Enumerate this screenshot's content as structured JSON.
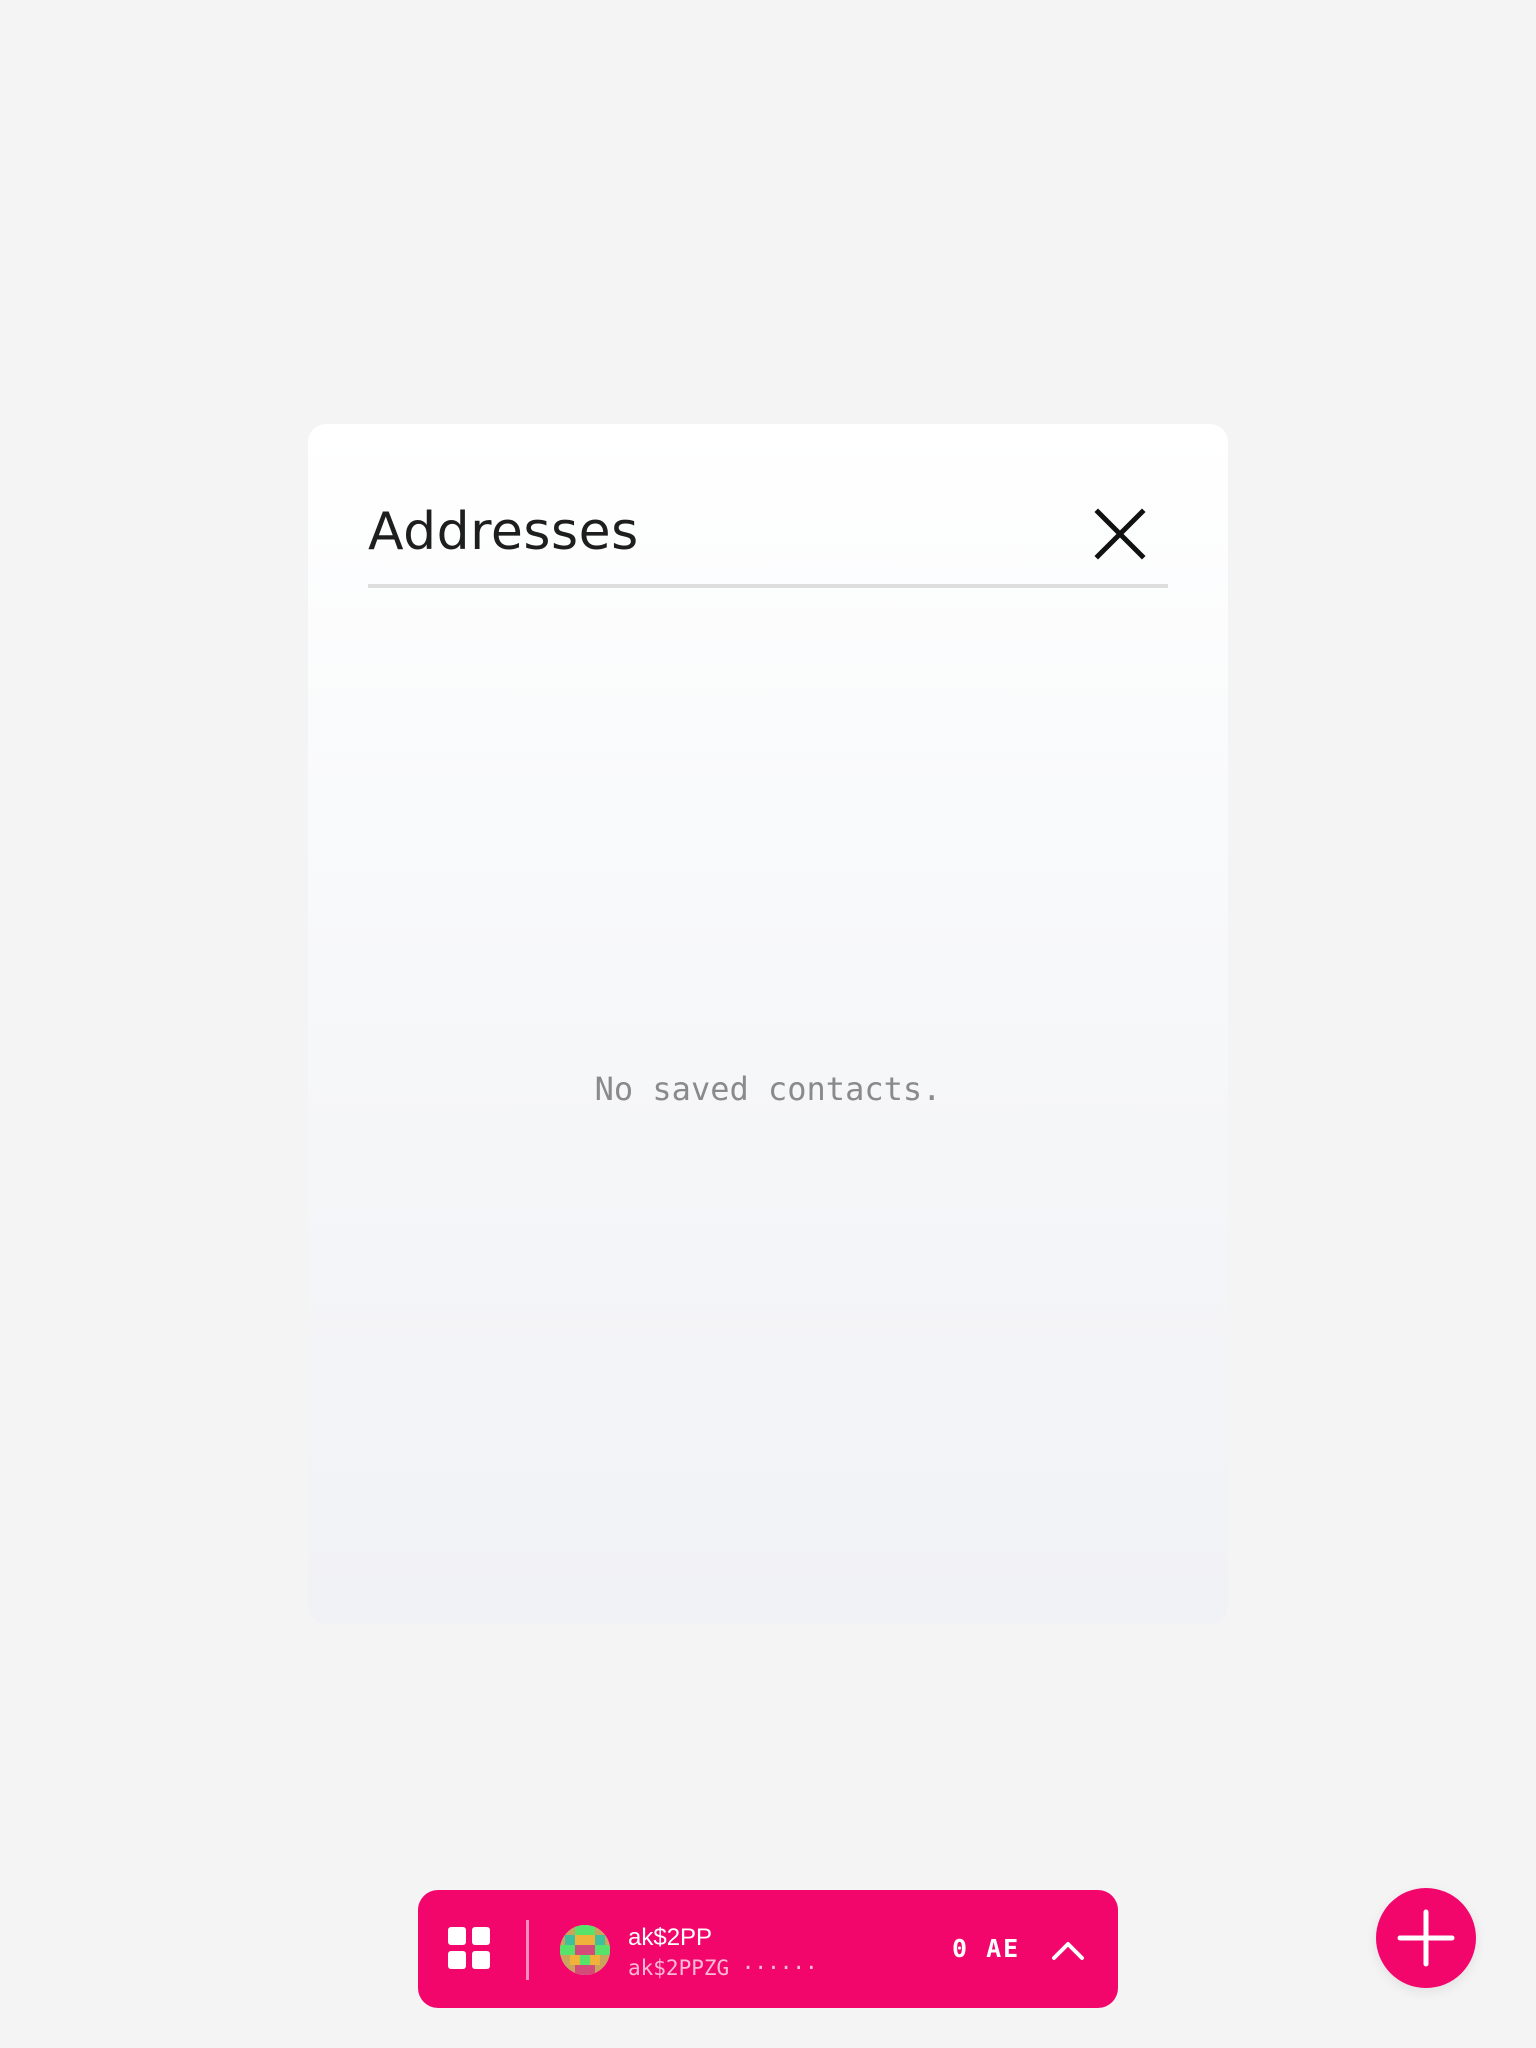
{
  "modal": {
    "title": "Addresses",
    "empty_message": "No saved contacts."
  },
  "account_bar": {
    "account_name": "ak$2PP",
    "account_address": "ak$2PPZG ······",
    "balance": "0 AE"
  },
  "icons": {
    "close": "close-icon",
    "apps": "apps-grid-icon",
    "avatar": "identicon-avatar",
    "expand": "chevron-up-icon",
    "add": "plus-icon"
  },
  "colors": {
    "accent": "#f2066c",
    "background": "#f4f4f4",
    "title_text": "#1e1e1e",
    "muted_text": "#8a8a8a"
  }
}
